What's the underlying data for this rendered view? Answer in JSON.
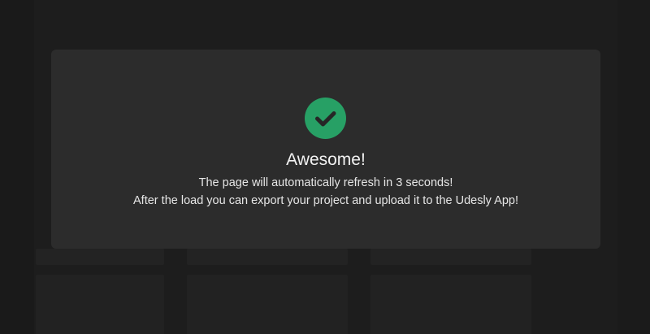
{
  "background": {
    "tiles": [
      {
        "label": ""
      },
      {
        "label": ""
      },
      {
        "label": ""
      }
    ]
  },
  "modal": {
    "icon": "check-circle-icon",
    "icon_color": "#27a065",
    "title": "Awesome!",
    "message_line1": "The page will automatically refresh in 3 seconds!",
    "message_line2": "After the load you can export your project and upload it to the Udesly App!"
  }
}
